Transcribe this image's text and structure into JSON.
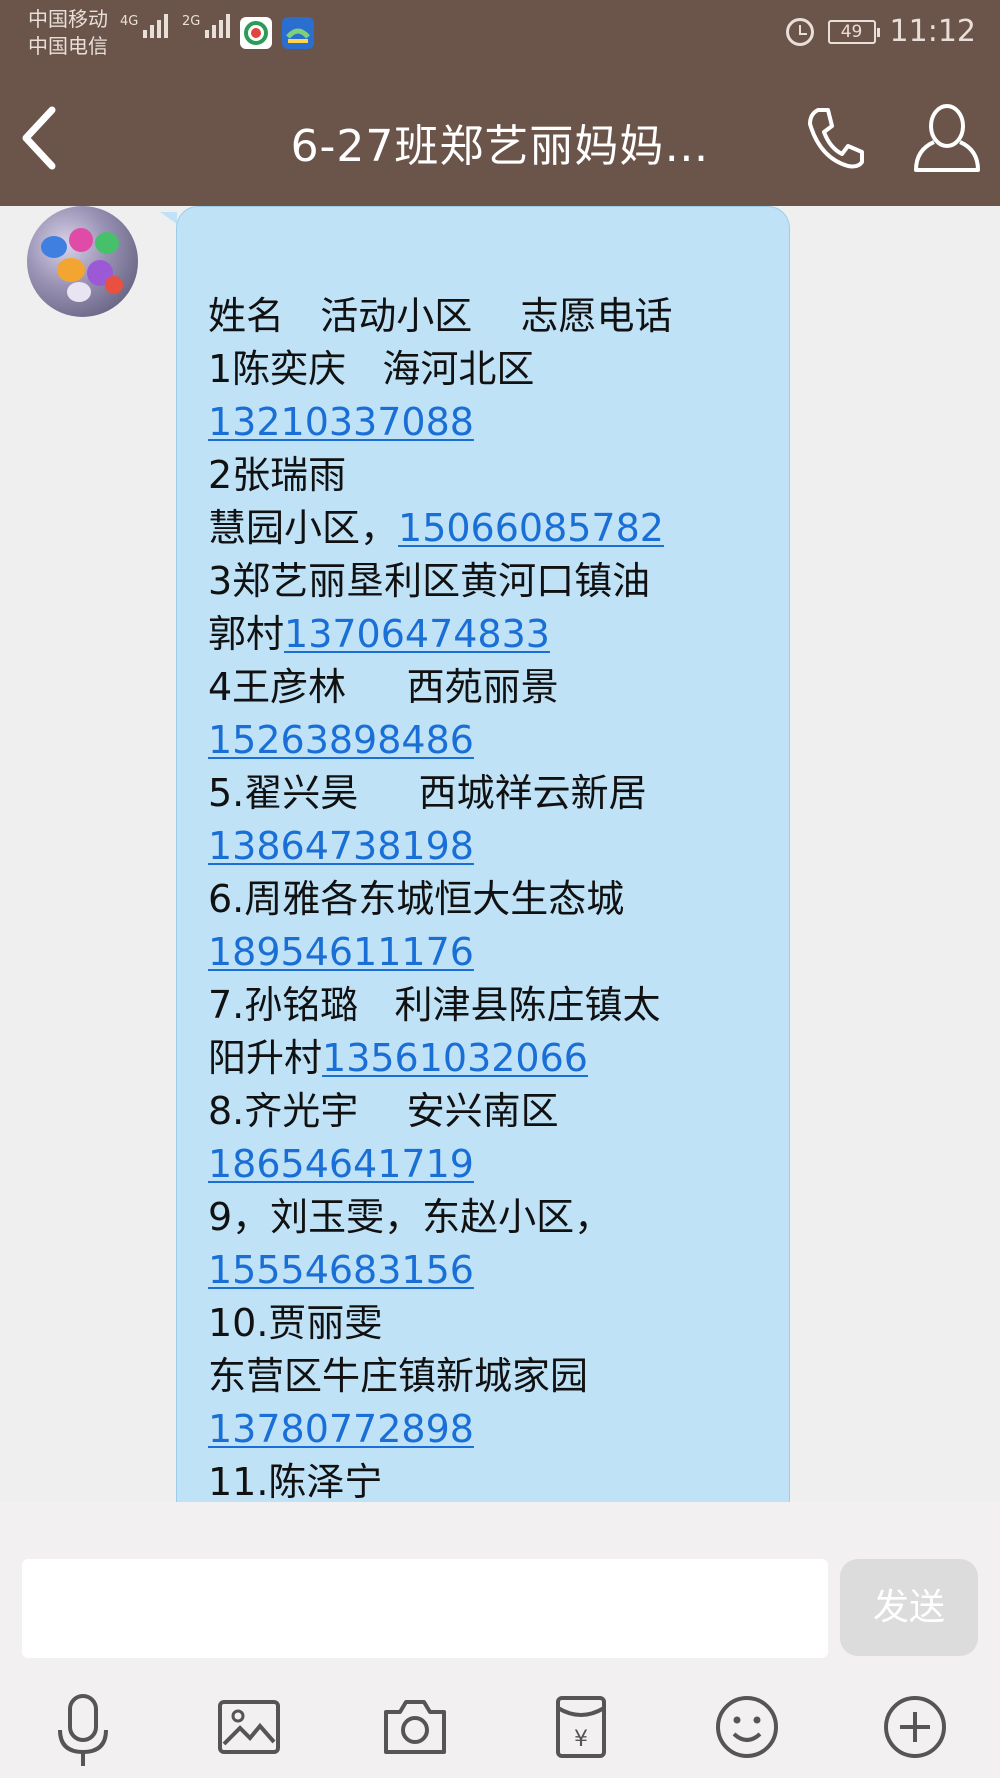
{
  "status_bar": {
    "carrier_1": "中国移动",
    "carrier_2": "中国电信",
    "network_1": "4G",
    "network_2": "2G",
    "battery": "49",
    "time": "11:12"
  },
  "header": {
    "title": "6-27班郑艺丽妈妈…",
    "icons": [
      "back-icon",
      "phone-icon",
      "profile-icon"
    ]
  },
  "message": {
    "lines": [
      [
        {
          "t": "姓名   活动小区    志愿电话"
        }
      ],
      [
        {
          "t": "1陈奕庆   海河北区"
        }
      ],
      [
        {
          "t": "13210337088",
          "link": true
        }
      ],
      [
        {
          "t": "2张瑞雨"
        }
      ],
      [
        {
          "t": "慧园小区，"
        },
        {
          "t": "15066085782",
          "link": true
        }
      ],
      [
        {
          "t": "3郑艺丽垦利区黄河口镇油"
        }
      ],
      [
        {
          "t": "郭村"
        },
        {
          "t": "13706474833",
          "link": true
        }
      ],
      [
        {
          "t": "4王彦林     西苑丽景"
        }
      ],
      [
        {
          "t": "15263898486",
          "link": true
        }
      ],
      [
        {
          "t": "5.翟兴昊     西城祥云新居"
        }
      ],
      [
        {
          "t": "13864738198",
          "link": true
        }
      ],
      [
        {
          "t": "6.周雅各东城恒大生态城"
        }
      ],
      [
        {
          "t": "18954611176",
          "link": true
        }
      ],
      [
        {
          "t": "7.孙铭璐   利津县陈庄镇太"
        }
      ],
      [
        {
          "t": "阳升村"
        },
        {
          "t": "13561032066",
          "link": true
        }
      ],
      [
        {
          "t": "8.齐光宇    安兴南区"
        }
      ],
      [
        {
          "t": "18654641719",
          "link": true
        }
      ],
      [
        {
          "t": "9，刘玉雯，东赵小区，"
        }
      ],
      [
        {
          "t": "15554683156",
          "link": true
        }
      ],
      [
        {
          "t": "10.贾丽雯"
        }
      ],
      [
        {
          "t": "东营区牛庄镇新城家园"
        }
      ],
      [
        {
          "t": "13780772898",
          "link": true
        }
      ],
      [
        {
          "t": "11.陈泽宁"
        }
      ]
    ]
  },
  "composer": {
    "input_value": "",
    "send_label": "发送",
    "tools": [
      "microphone-icon",
      "image-icon",
      "camera-icon",
      "red-packet-icon",
      "emoji-icon",
      "plus-icon"
    ]
  },
  "colors": {
    "header_bg": "#6b544a",
    "bubble_bg": "#bfe2f7",
    "link": "#1a6fd6"
  }
}
